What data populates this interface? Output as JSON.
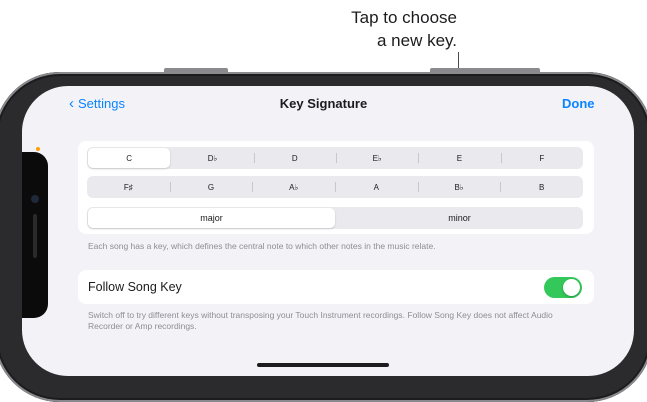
{
  "callout": {
    "line1": "Tap to choose",
    "line2": "a new key."
  },
  "nav": {
    "back_label": "Settings",
    "title": "Key Signature",
    "done_label": "Done"
  },
  "keys": {
    "row1": [
      "C",
      "D♭",
      "D",
      "E♭",
      "E",
      "F"
    ],
    "row2": [
      "F♯",
      "G",
      "A♭",
      "A",
      "B♭",
      "B"
    ],
    "selected": "C"
  },
  "mode": {
    "options": [
      "major",
      "minor"
    ],
    "selected": "major"
  },
  "key_caption": "Each song has a key, which defines the central note to which other notes in the music relate.",
  "follow_song_key": {
    "label": "Follow Song Key",
    "enabled": true,
    "caption": "Switch off to try different keys without transposing your Touch Instrument recordings. Follow Song Key does not affect Audio Recorder or Amp recordings."
  },
  "colors": {
    "accent": "#0a84ff",
    "toggle_on": "#34c759",
    "background": "#f2f2f7"
  }
}
